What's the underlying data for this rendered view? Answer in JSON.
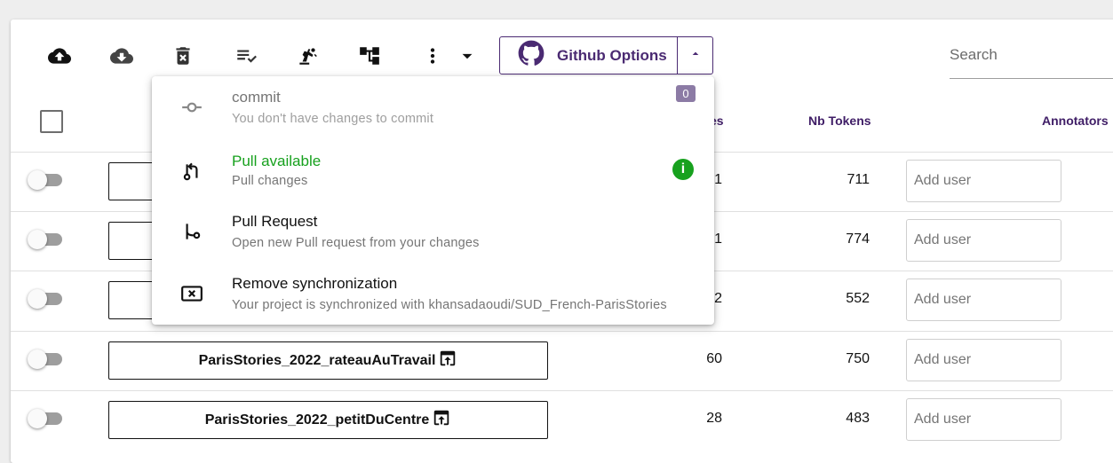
{
  "colors": {
    "accent": "#4a2a72",
    "green": "#17a11e",
    "badge": "#8c7ba5"
  },
  "toolbar": {
    "icons": [
      "upload-icon",
      "download-icon",
      "delete-icon",
      "tasks-icon",
      "robot-arm-icon",
      "tree-icon",
      "more-vert-icon",
      "dropdown-icon"
    ],
    "github_label": "Github Options"
  },
  "search": {
    "placeholder": "Search"
  },
  "columns": {
    "sentences": "es",
    "tokens": "Nb Tokens",
    "annotators": "Annotators"
  },
  "menu": {
    "commit": {
      "title": "commit",
      "subtitle": "You don't have changes to commit",
      "badge": "0"
    },
    "pull": {
      "title": "Pull available",
      "subtitle": "Pull changes",
      "info": "i"
    },
    "pull_request": {
      "title": "Pull Request",
      "subtitle": "Open new Pull request from your changes"
    },
    "remove_sync": {
      "title": "Remove synchronization",
      "subtitle": "Your project is synchronized with khansadaoudi/SUD_French-ParisStories"
    }
  },
  "rows": [
    {
      "name": "",
      "sentences": "1",
      "tokens": "711",
      "user_placeholder": "Add user"
    },
    {
      "name": "",
      "sentences": "1",
      "tokens": "774",
      "user_placeholder": "Add user"
    },
    {
      "name": "",
      "sentences": "2",
      "tokens": "552",
      "user_placeholder": "Add user"
    },
    {
      "name": "ParisStories_2022_rateauAuTravail",
      "sentences": "60",
      "tokens": "750",
      "user_placeholder": "Add user"
    },
    {
      "name": "ParisStories_2022_petitDuCentre",
      "sentences": "28",
      "tokens": "483",
      "user_placeholder": "Add user"
    }
  ]
}
